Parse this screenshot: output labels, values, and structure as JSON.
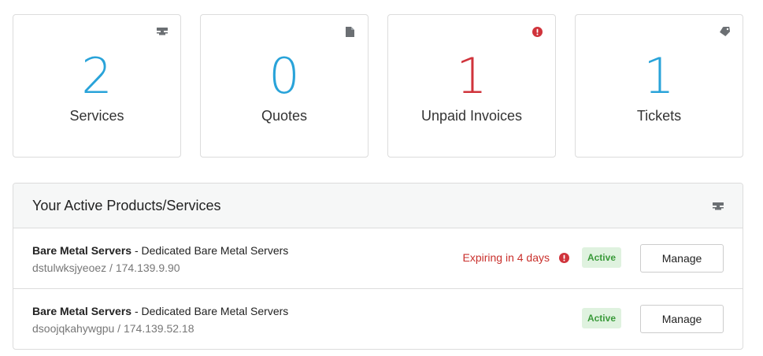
{
  "stats": [
    {
      "number": "2",
      "label": "Services",
      "icon": "server-icon",
      "color": "#29a3d9"
    },
    {
      "number": "0",
      "label": "Quotes",
      "icon": "document-icon",
      "color": "#29a3d9"
    },
    {
      "number": "1",
      "label": "Unpaid Invoices",
      "icon": "exclamation-circle-icon",
      "color": "#d0333b"
    },
    {
      "number": "1",
      "label": "Tickets",
      "icon": "tag-icon",
      "color": "#29a3d9"
    }
  ],
  "panel": {
    "title": "Your Active Products/Services",
    "header_icon": "server-icon"
  },
  "services": [
    {
      "product": "Bare Metal Servers",
      "group": " - Dedicated Bare Metal Servers",
      "host": "dstulwksjyeoez / 174.139.9.90",
      "expiry": "Expiring in 4 days",
      "status": "Active",
      "manage_label": "Manage"
    },
    {
      "product": "Bare Metal Servers",
      "group": " - Dedicated Bare Metal Servers",
      "host": "dsoojqkahywgpu / 174.139.52.18",
      "expiry": "",
      "status": "Active",
      "manage_label": "Manage"
    }
  ],
  "colors": {
    "accent_blue": "#29a3d9",
    "alert_red": "#d0333b",
    "active_green": "#3a9a3a",
    "icon_gray": "#6b6f73"
  }
}
